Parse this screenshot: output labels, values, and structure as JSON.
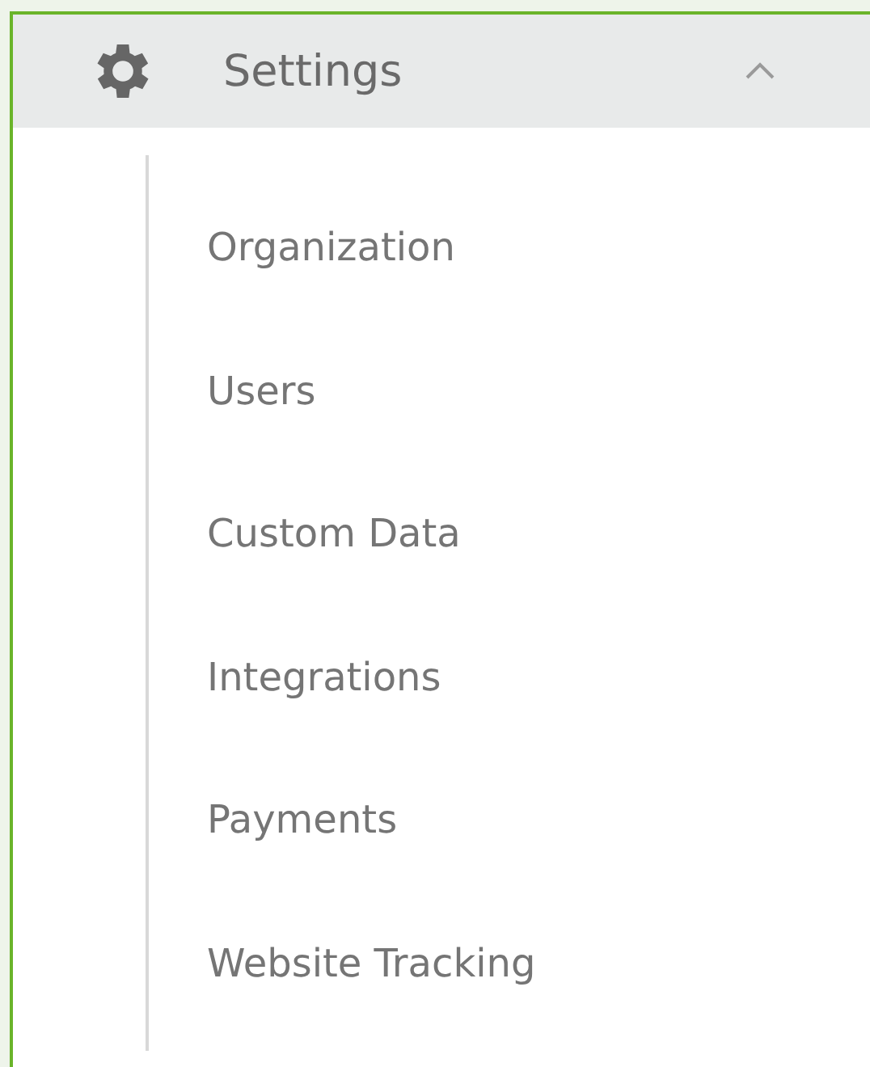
{
  "section": {
    "title": "Settings",
    "expanded": true,
    "items": [
      {
        "label": "Organization"
      },
      {
        "label": "Users"
      },
      {
        "label": "Custom Data"
      },
      {
        "label": "Integrations"
      },
      {
        "label": "Payments"
      },
      {
        "label": "Website Tracking"
      }
    ]
  }
}
